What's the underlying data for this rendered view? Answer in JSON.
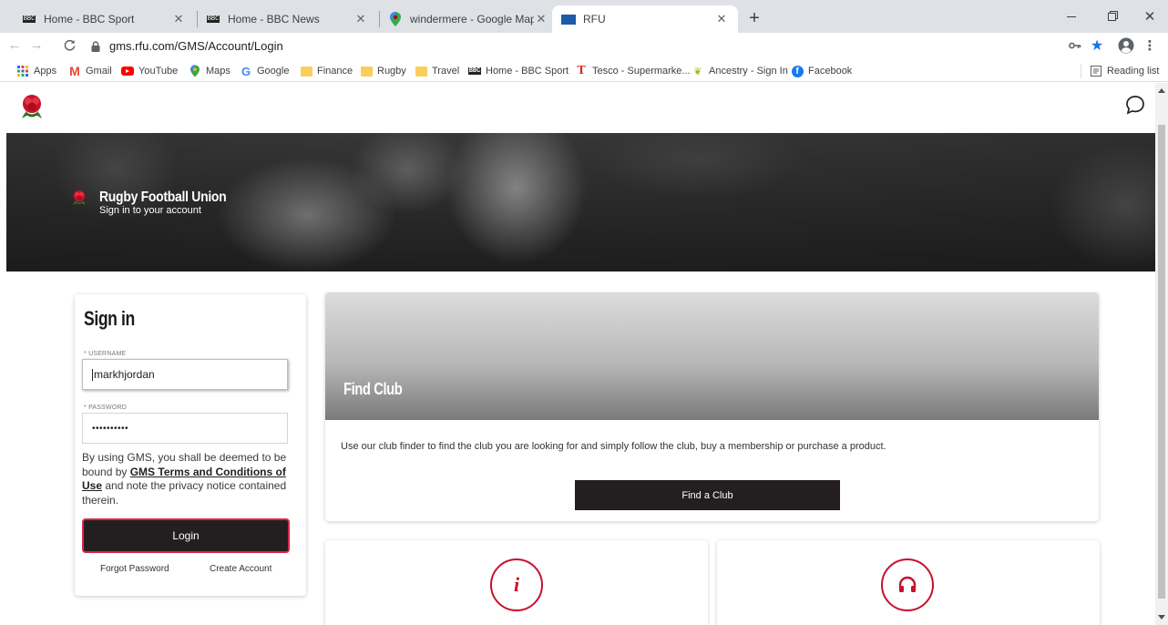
{
  "browser": {
    "tabs": [
      {
        "title": "Home - BBC Sport",
        "icon": "bbc-icon",
        "active": false
      },
      {
        "title": "Home - BBC News",
        "icon": "bbc-icon",
        "active": false
      },
      {
        "title": "windermere - Google Maps",
        "icon": "maps-pin-icon",
        "active": false
      },
      {
        "title": "RFU",
        "icon": "rfu-icon",
        "active": true
      }
    ],
    "new_tab": "+",
    "url": "gms.rfu.com/GMS/Account/Login",
    "bookmarks": [
      {
        "label": "Apps",
        "icon": "apps-grid-icon"
      },
      {
        "label": "Gmail",
        "icon": "gmail-icon"
      },
      {
        "label": "YouTube",
        "icon": "youtube-icon"
      },
      {
        "label": "Maps",
        "icon": "maps-pin-icon"
      },
      {
        "label": "Google",
        "icon": "google-icon"
      },
      {
        "label": "Finance",
        "icon": "folder-icon"
      },
      {
        "label": "Rugby",
        "icon": "folder-icon"
      },
      {
        "label": "Travel",
        "icon": "folder-icon"
      },
      {
        "label": "Home - BBC Sport",
        "icon": "bbc-icon"
      },
      {
        "label": "Tesco - Supermarke...",
        "icon": "tesco-icon"
      },
      {
        "label": "Ancestry - Sign In",
        "icon": "ancestry-icon"
      },
      {
        "label": "Facebook",
        "icon": "facebook-icon"
      }
    ],
    "reading_list": "Reading list",
    "bbc_mark": "BBC"
  },
  "hero": {
    "title": "Rugby Football Union",
    "subtitle": "Sign in to your account"
  },
  "signin": {
    "heading": "Sign in",
    "username_label": "* USERNAME",
    "username_value": "markhjordan",
    "password_label": "* PASSWORD",
    "password_value": "••••••••••",
    "terms_prefix": "By using GMS, you shall be deemed to be bound by ",
    "terms_link": "GMS Terms and Conditions of Use",
    "terms_suffix": " and note the privacy notice contained therein.",
    "login_label": "Login",
    "forgot_label": "Forgot Password",
    "create_label": "Create Account"
  },
  "find_club": {
    "title": "Find Club",
    "description": "Use our club finder to find the club you are looking for and simply follow the club, buy a membership or purchase a product.",
    "button_label": "Find a Club"
  },
  "info_cards": [
    {
      "icon": "info-icon",
      "glyph": "i"
    },
    {
      "icon": "headset-icon"
    }
  ],
  "colors": {
    "accent_red": "#c8102e",
    "login_border": "#d6294a",
    "button_dark": "#231f20",
    "tab_strip": "#dee1e6"
  }
}
